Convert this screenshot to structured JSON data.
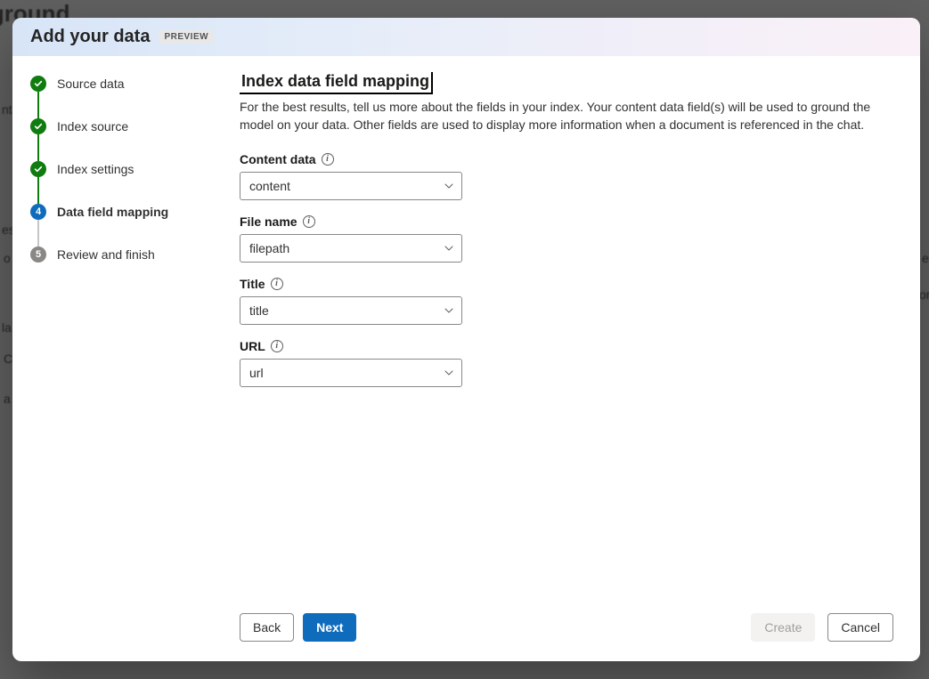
{
  "background": {
    "heading_fragment": "ayground",
    "snippets": [
      "nt",
      "es",
      "o",
      "la",
      "C",
      "a",
      "e",
      "or"
    ]
  },
  "modal": {
    "title": "Add your data",
    "badge": "PREVIEW"
  },
  "steps": [
    {
      "label": "Source data",
      "state": "done"
    },
    {
      "label": "Index source",
      "state": "done"
    },
    {
      "label": "Index settings",
      "state": "done"
    },
    {
      "label": "Data field mapping",
      "state": "current"
    },
    {
      "label": "Review and finish",
      "state": "pending"
    }
  ],
  "section": {
    "title": "Index data field mapping",
    "description": "For the best results, tell us more about the fields in your index. Your content data field(s) will be used to ground the model on your data. Other fields are used to display more information when a document is referenced in the chat."
  },
  "fields": {
    "content": {
      "label": "Content data",
      "value": "content"
    },
    "file": {
      "label": "File name",
      "value": "filepath"
    },
    "title": {
      "label": "Title",
      "value": "title"
    },
    "url": {
      "label": "URL",
      "value": "url"
    }
  },
  "footer": {
    "back": "Back",
    "next": "Next",
    "create": "Create",
    "cancel": "Cancel"
  }
}
